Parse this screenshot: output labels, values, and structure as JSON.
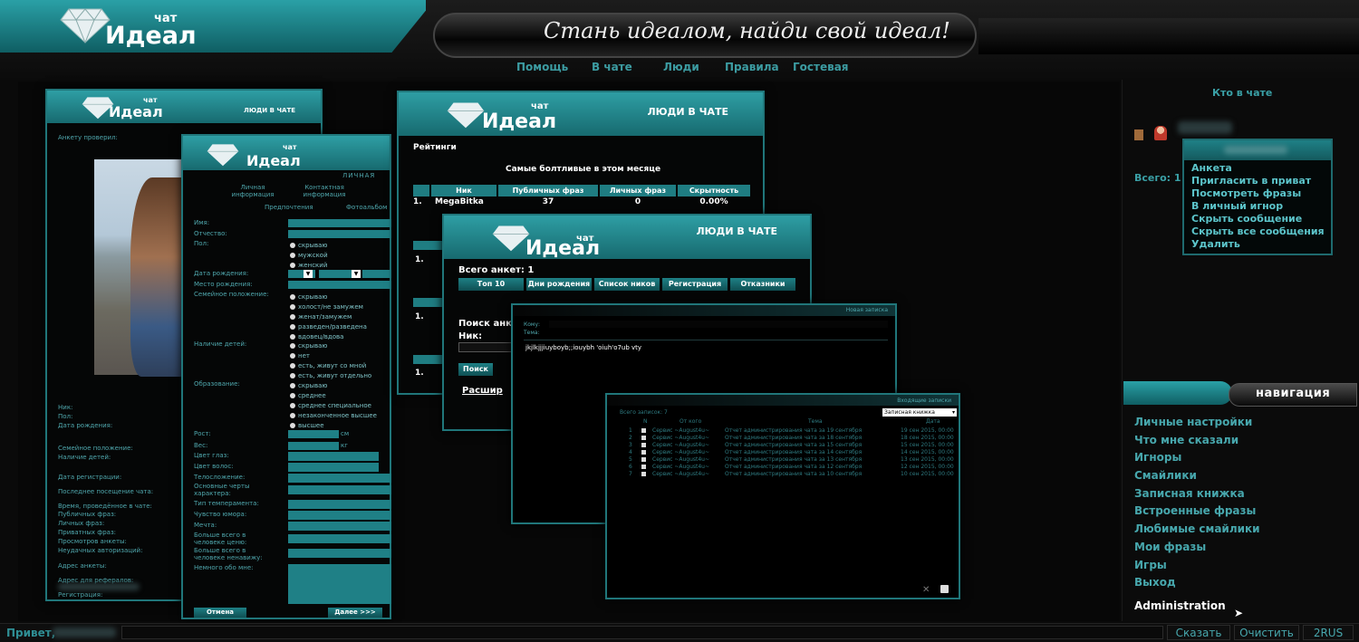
{
  "header": {
    "logo_small": "чат",
    "logo_big": "Идеал",
    "slogan": "Стань идеалом, найди свой идеал!",
    "menu": [
      "Помощь",
      "В чате",
      "Люди",
      "Правила",
      "Гостевая"
    ]
  },
  "profile_window": {
    "title": "ЛЮДИ В ЧАТЕ",
    "logo_small": "чат",
    "logo_big": "Идеал",
    "checked_label": "Анкету проверил:",
    "labels": [
      "Ник:",
      "Пол:",
      "Дата рождения:",
      "Семейное положение:",
      "Наличие детей:",
      "Дата регистрации:",
      "Последнее посещение чата:",
      "Время, проведённое в чате:",
      "Публичных фраз:",
      "Личных фраз:",
      "Приватных фраз:",
      "Просмотров анкеты:",
      "Неудачных авторизаций:",
      "Адрес анкеты:",
      "Адрес для рефералов:",
      "Регистрация:"
    ]
  },
  "form_window": {
    "logo_small": "чат",
    "logo_big": "Идеал",
    "section": "ЛИЧНАЯ",
    "tab1": "Личная информация",
    "tab2": "Контактная информация",
    "tab3": "Предпочтения",
    "tab4": "Фотоальбом",
    "fields": [
      "Имя:",
      "Отчество:",
      "Пол:",
      "Дата рождения:",
      "Место рождения:",
      "Семейное положение:",
      "Наличие детей:",
      "Образование:",
      "Рост:",
      "Вес:",
      "Цвет глаз:",
      "Цвет волос:",
      "Телосложение:",
      "Основные черты характера:",
      "Тип темперамента:",
      "Чувство юмора:",
      "Мечта:",
      "Больше всего в человеке ценю:",
      "Больше всего в человеке ненавижу:",
      "Немного обо мне:"
    ],
    "gender_options": [
      "скрываю",
      "мужской",
      "женский"
    ],
    "family_options": [
      "скрываю",
      "холост/не замужем",
      "женат/замужем",
      "разведен/разведена",
      "вдовец/вдова"
    ],
    "children_options": [
      "скрываю",
      "нет",
      "есть, живут со мной",
      "есть, живут отдельно"
    ],
    "education_options": [
      "скрываю",
      "среднее",
      "среднее специальное",
      "незаконченное высшее",
      "высшее"
    ],
    "height_unit": "см",
    "weight_unit": "кг",
    "cancel": "Отмена",
    "next": "Далее >>>"
  },
  "ratings_window": {
    "title": "ЛЮДИ В ЧАТЕ",
    "logo_small": "чат",
    "logo_big": "Идеал",
    "heading": "Рейтинги",
    "subheading": "Самые болтливые в этом месяце",
    "columns": [
      "Ник",
      "Публичных фраз",
      "Личных фраз",
      "Скрытность"
    ],
    "rows": [
      {
        "n": "1.",
        "nick": "MegaBitka",
        "pub": "37",
        "priv": "0",
        "hide": "0.00%"
      }
    ],
    "side_numbers": [
      "1.",
      "1.",
      "1."
    ]
  },
  "search_window": {
    "title": "ЛЮДИ В ЧАТЕ",
    "logo_small": "чат",
    "logo_big": "Идеал",
    "total": "Всего анкет: 1",
    "tabs": [
      "Топ 10",
      "Дни рождения",
      "Список ников",
      "Регистрация",
      "Отказники"
    ],
    "search_label": "Поиск анк",
    "nick_label": "Ник:",
    "search_button": "Поиск",
    "extended": "Расшир"
  },
  "compose_window": {
    "title": "Новая записка",
    "to_label": "Кому:",
    "subject_label": "Тема:",
    "body": "jkjlkjjjiuyboyb;;iouybh 'oiuh'o7ub vty"
  },
  "inbox_window": {
    "title": "Входящие записки",
    "count": "Всего записок: 7",
    "folder": "Записная книжка",
    "columns": [
      "N",
      "От кого",
      "Тема",
      "Дата"
    ],
    "rows": [
      {
        "n": "1",
        "from": "Сервис ~August4u~",
        "subject": "Отчет администрирования чата за 19 сентября",
        "date": "19 сен 2015, 00:00"
      },
      {
        "n": "2",
        "from": "Сервис ~August4u~",
        "subject": "Отчет администрирования чата за 18 сентября",
        "date": "18 сен 2015, 00:00"
      },
      {
        "n": "3",
        "from": "Сервис ~August4u~",
        "subject": "Отчет администрирования чата за 15 сентября",
        "date": "15 сен 2015, 00:00"
      },
      {
        "n": "4",
        "from": "Сервис ~August4u~",
        "subject": "Отчет администрирования чата за 14 сентября",
        "date": "14 сен 2015, 00:00"
      },
      {
        "n": "5",
        "from": "Сервис ~August4u~",
        "subject": "Отчет администрирования чата за 13 сентября",
        "date": "13 сен 2015, 00:00"
      },
      {
        "n": "6",
        "from": "Сервис ~August4u~",
        "subject": "Отчет администрирования чата за 12 сентября",
        "date": "12 сен 2015, 00:00"
      },
      {
        "n": "7",
        "from": "Сервис ~August4u~",
        "subject": "Отчет администрирования чата за 10 сентября",
        "date": "10 сен 2015, 00:00"
      }
    ]
  },
  "sidebar": {
    "who_title": "Кто в чате",
    "total": "Всего: 1",
    "context_menu": [
      "Анкета",
      "Пригласить в приват",
      "Посмотреть фразы",
      "В личный игнор",
      "Скрыть сообщение",
      "Скрыть все сообщения",
      "Удалить"
    ],
    "nav_title": "навигация",
    "nav_items": [
      "Личные настройки",
      "Что мне сказали",
      "Игноры",
      "Смайлики",
      "Записная книжка",
      "Встроенные фразы",
      "Любимые смайлики",
      "Мои фразы",
      "Игры",
      "Выход"
    ],
    "admin": "Administration"
  },
  "bottom": {
    "greeting": "Привет,",
    "say": "Сказать",
    "clear": "Очистить",
    "lang": "2RUS"
  },
  "colors": {
    "teal": "#1f7d82",
    "bg": "#0a0a0a",
    "link": "#47a7ad"
  }
}
